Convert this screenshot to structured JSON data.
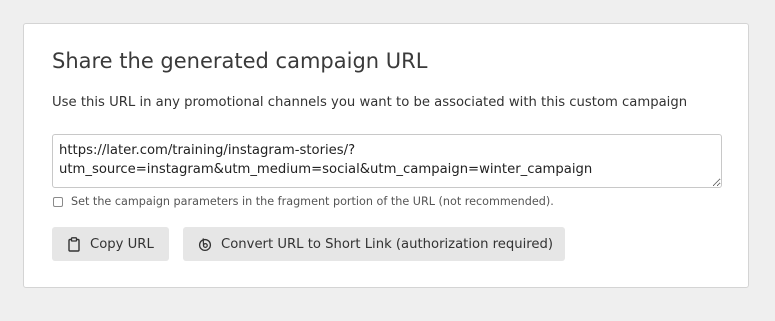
{
  "panel": {
    "title": "Share the generated campaign URL",
    "description": "Use this URL in any promotional channels you want to be associated with this custom campaign"
  },
  "url_field": {
    "value": "https://later.com/training/instagram-stories/?\nutm_source=instagram&utm_medium=social&utm_campaign=winter_campaign"
  },
  "fragment_option": {
    "label": "Set the campaign parameters in the fragment portion of the URL (not recommended).",
    "checked": false
  },
  "buttons": {
    "copy": {
      "label": "Copy URL",
      "icon": "clipboard-icon"
    },
    "short_link": {
      "label": "Convert URL to Short Link (authorization required)",
      "icon": "bitly-icon"
    }
  },
  "colors": {
    "page_background": "#efefef",
    "card_background": "#ffffff",
    "button_background": "#e6e6e6"
  }
}
